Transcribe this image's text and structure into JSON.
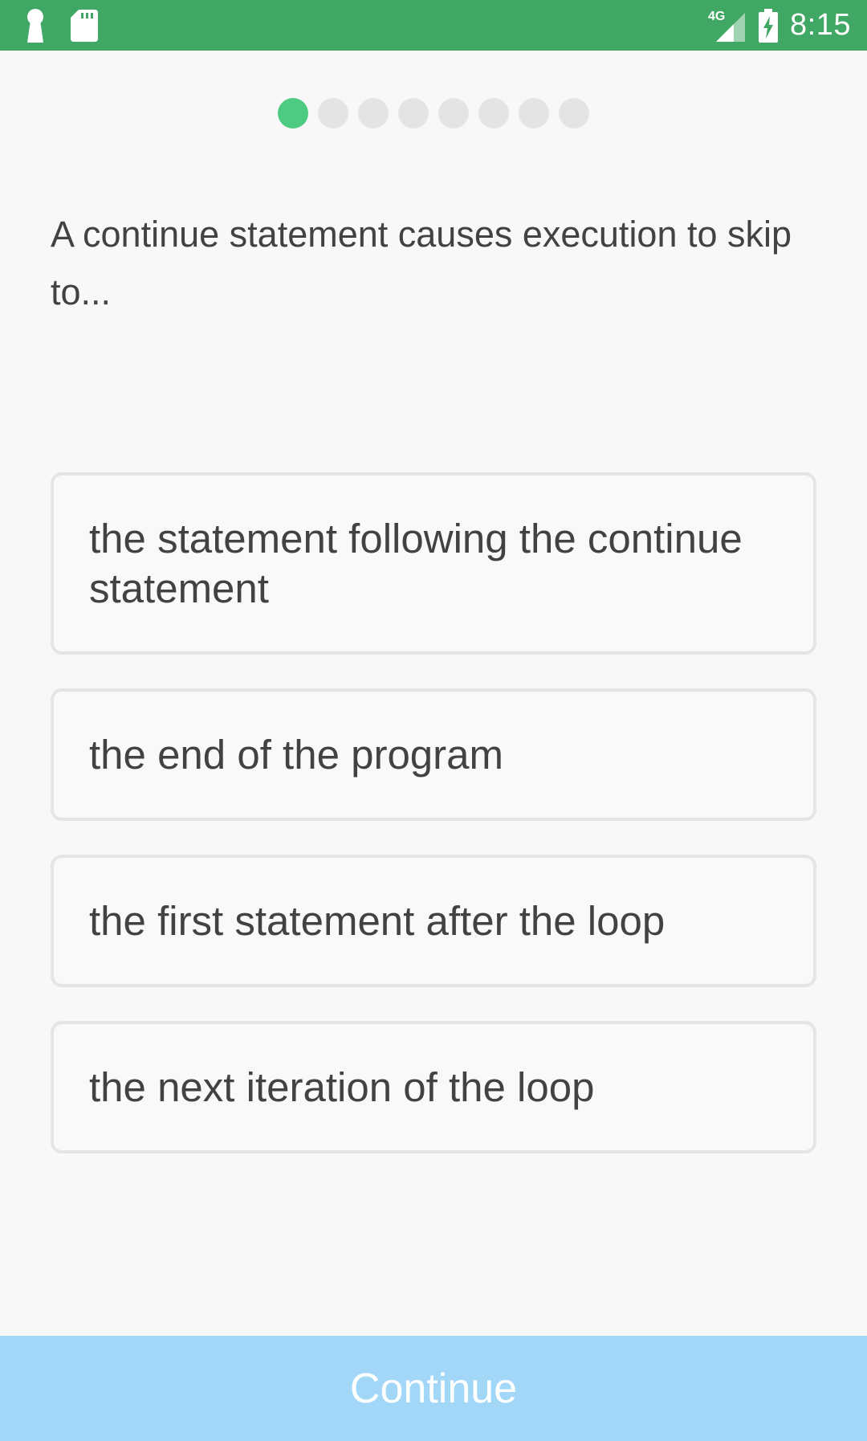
{
  "status_bar": {
    "time": "8:15",
    "network": "4G",
    "left_icons": [
      "keyhole-icon",
      "sd-card-icon"
    ],
    "right_icons": [
      "signal-icon",
      "battery-charging-icon"
    ]
  },
  "progress": {
    "total_steps": 8,
    "current_step": 1,
    "active_color": "#4ecb82",
    "inactive_color": "#e4e4e4"
  },
  "question": {
    "text": "A continue statement causes execution to skip to..."
  },
  "options": [
    {
      "label": "the statement following the continue statement"
    },
    {
      "label": "the end of the program"
    },
    {
      "label": "the first statement after the loop"
    },
    {
      "label": "the next iteration of the loop"
    }
  ],
  "continue_button": {
    "label": "Continue",
    "background": "#a2d7f8"
  },
  "colors": {
    "status_bar": "#41a764",
    "background": "#f8f8f8",
    "text": "#424242",
    "option_border": "#e5e5e5"
  }
}
